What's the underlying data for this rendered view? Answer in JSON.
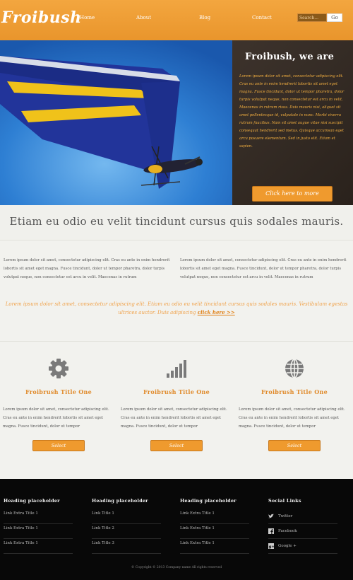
{
  "header": {
    "logo": "Froibush",
    "nav": [
      "Home",
      "About",
      "Blog",
      "Contact"
    ],
    "search_placeholder": "Search...",
    "search_button": "Go"
  },
  "hero": {
    "title": "Froibush, we are",
    "text": "Lorem ipsum dolor sit amet, consectetur adipiscing elit. Cras eu ante in enim hendrerit lobortis sit amet eget magna. Fusce tincidunt, dolor ut tempor pharetra, dolor turpis volutpat neque, non consectetur est arcu in velit. Maecenas in rutrum risus. Duis mauris nisi, aliquet sit amet pellentesque id, vulputate in nunc. Morbi viverra rutrum faucibus. Nam sit amet augue vitae nisi suscipit consequat hendrerit sed metus. Quisque accumsan eget arcu posuere elementum. Sed in justo elit. Etiam et sapien.",
    "button": "Click here to more"
  },
  "tagline": "Etiam eu odio eu velit tincidunt cursus quis sodales mauris.",
  "intro": [
    "Lorem ipsum dolor sit amet, consectetur adipiscing elit. Cras eu ante in enim hendrerit lobortis sit amet eget magna. Fusce tincidunt, dolor ut tempor pharetra, dolor turpis volutpat neque, non consectetur est arcu in velit. Maecenas in rutrum",
    "Lorem ipsum dolor sit amet, consectetur adipiscing elit. Cras eu ante in enim hendrerit lobortis sit amet eget magna. Fusce tincidunt, dolor ut tempor pharetra, dolor turpis volutpat neque, non consectetur est arcu in velit. Maecenas in rutrum"
  ],
  "highlight": {
    "text": "Lorem ipsum dolor sit amet, consectetur adipiscing elit. Etiam eu odio eu velit tincidunt cursus quis sodales mauris. Vestibulum egestas ultrices auctor. Duis adipiscing",
    "link": "click here >>"
  },
  "features": [
    {
      "icon": "gear-icon",
      "title": "Froibrush Title One",
      "text": "Lorem ipsum dolor sit amet, consectetur adipiscing elit. Cras eu ante in enim hendrerit lobortis sit amet eget magna. Fusce tincidunt, dolor ut tempor",
      "button": "Select"
    },
    {
      "icon": "signal-bars-icon",
      "title": "Froibrush Title One",
      "text": "Lorem ipsum dolor sit amet, consectetur adipiscing elit. Cras eu ante in enim hendrerit lobortis sit amet eget magna. Fusce tincidunt, dolor ut tempor",
      "button": "Select"
    },
    {
      "icon": "globe-icon",
      "title": "Froibrush Title One",
      "text": "Lorem ipsum dolor sit amet, consectetur adipiscing elit. Cras eu ante in enim hendrerit lobortis sit amet eget magna. Fusce tincidunt, dolor ut tempor",
      "button": "Select"
    }
  ],
  "footer": {
    "columns": [
      {
        "heading": "Heading placeholder",
        "links": [
          "Link Extra Title 1",
          "Link Extra Title 1",
          "Link Extra Title 1"
        ]
      },
      {
        "heading": "Heading placeholder",
        "links": [
          "Link Title 1",
          "Link Title 2",
          "Link Title 3"
        ]
      },
      {
        "heading": "Heading placeholder",
        "links": [
          "Link Extra Title 1",
          "Link Extra Title 1",
          "Link Extra Title 1"
        ]
      }
    ],
    "social": {
      "heading": "Social Links",
      "items": [
        {
          "label": "Twitter",
          "icon": "twitter-icon"
        },
        {
          "label": "Facebook",
          "icon": "facebook-icon"
        },
        {
          "label": "Google +",
          "icon": "google-plus-icon"
        }
      ]
    },
    "copyright": "© Copyright © 2013 Company name All rights reserved"
  },
  "colors": {
    "accent": "#ef9a2e",
    "header": "#f3a63f",
    "footer": "#080808",
    "hero_text": "#f4b040"
  }
}
